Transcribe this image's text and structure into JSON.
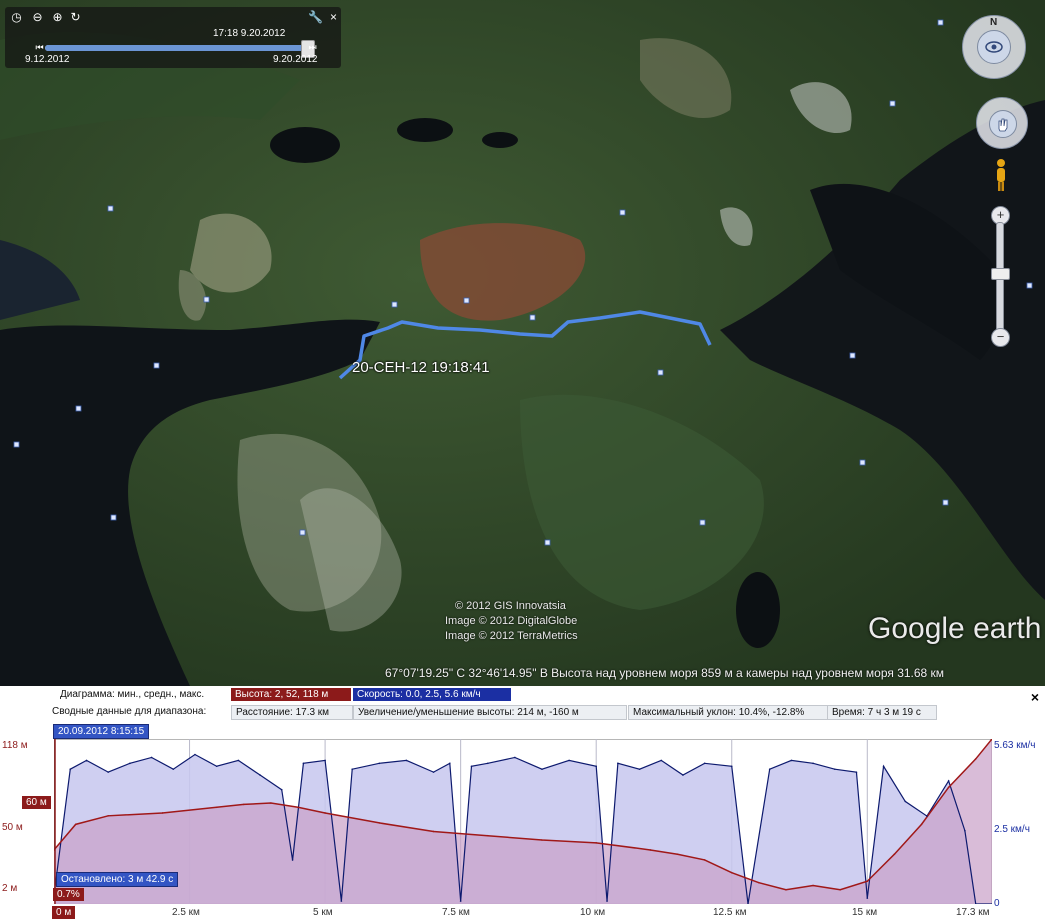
{
  "time_slider": {
    "current_time": "17:18 9.20.2012",
    "start_date": "9.12.2012",
    "end_date": "9.20.2012",
    "position": 0.97
  },
  "map": {
    "path_label": "20-СЕН-12 19:18:41",
    "copyright": [
      "© 2012 GIS Innovatsia",
      "Image © 2012 DigitalGlobe",
      "Image © 2012 TerraMetrics"
    ],
    "logo": "Google earth",
    "status": "67°07'19.25\" С  32°46'14.95\" В  Высота над уровнем моря  859 м  а камеры над уровнем моря    31.68 км",
    "compass_letter": "N"
  },
  "profile": {
    "diagram_label": "Диаграмма: мин., средн., макс.",
    "elevation_chip": "Высота: 2, 52, 118 м",
    "speed_chip": "Скорость: 0.0, 2.5, 5.6 км/ч",
    "summary_label": "Сводные данные для диапазона:",
    "distance": "Расстояние: 17.3 км",
    "gain_loss": "Увеличение/уменьшение высоты: 214 м, -160 м",
    "max_slope": "Максимальный уклон: 10.4%, -12.8%",
    "time": "Время: 7 ч 3 м 19 с",
    "date_badge": "20.09.2012 8:15:15",
    "stopped": "Остановлено: 3 м 42.9 с",
    "slope_badge": "0.7%",
    "cursor_badge": "60 м",
    "close": "×"
  },
  "chart_data": {
    "type": "area",
    "x_unit": "км",
    "xlim": [
      0,
      17.3
    ],
    "x_ticks": [
      "0 м",
      "2.5 км",
      "5 км",
      "7.5 км",
      "10 км",
      "12.5 км",
      "15 км",
      "17.3 км"
    ],
    "y_left_ticks": [
      "118 м",
      "50 м",
      "2 м"
    ],
    "y_right_ticks": [
      "5.63 км/ч",
      "2.5 км/ч",
      "0"
    ],
    "series": [
      {
        "name": "Высота",
        "unit": "м",
        "ylim": [
          2,
          118
        ],
        "color": "#a01818",
        "fill": "#c9a0c8",
        "x": [
          0,
          0.4,
          1,
          2,
          3,
          3.5,
          4,
          4.5,
          5,
          6,
          7,
          8,
          9,
          10,
          11,
          11.5,
          12,
          12.5,
          13,
          13.5,
          14,
          14.5,
          15,
          15.5,
          16,
          16.5,
          17,
          17.3
        ],
        "values": [
          40,
          58,
          64,
          66,
          70,
          72,
          73,
          70,
          66,
          59,
          53,
          50,
          47,
          45,
          40,
          37,
          33,
          24,
          17,
          12,
          15,
          12,
          18,
          37,
          58,
          84,
          104,
          118
        ]
      },
      {
        "name": "Скорость",
        "unit": "км/ч",
        "ylim": [
          0,
          5.63
        ],
        "color": "#0d1a6e",
        "fill": "#c7c7ee",
        "x": [
          0,
          0.3,
          0.6,
          1,
          1.4,
          1.8,
          2.2,
          2.6,
          3,
          3.4,
          3.8,
          4.2,
          4.4,
          4.6,
          5.0,
          5.3,
          5.5,
          6,
          6.5,
          7,
          7.3,
          7.5,
          7.7,
          8,
          8.5,
          9,
          9.5,
          10,
          10.2,
          10.4,
          10.8,
          11.2,
          11.6,
          12,
          12.5,
          12.8,
          13.2,
          13.6,
          14,
          14.4,
          14.8,
          15,
          15.3,
          15.7,
          16.1,
          16.5,
          16.8,
          17,
          17.3
        ],
        "values": [
          0.3,
          4.6,
          4.9,
          4.5,
          4.8,
          5.0,
          4.6,
          5.1,
          4.7,
          4.9,
          4.4,
          3.9,
          1.5,
          4.8,
          4.9,
          0.1,
          4.6,
          4.8,
          4.9,
          4.5,
          4.8,
          0.1,
          4.7,
          4.8,
          5.0,
          4.6,
          4.9,
          4.7,
          0.1,
          4.8,
          4.6,
          4.9,
          4.4,
          4.8,
          4.7,
          0.0,
          4.6,
          4.9,
          4.8,
          4.6,
          4.5,
          0.2,
          4.7,
          3.5,
          3.0,
          4.2,
          2.5,
          0.0,
          0.0
        ]
      }
    ],
    "cursor": {
      "x": 0,
      "elevation": 60
    },
    "legend": "top-left"
  }
}
